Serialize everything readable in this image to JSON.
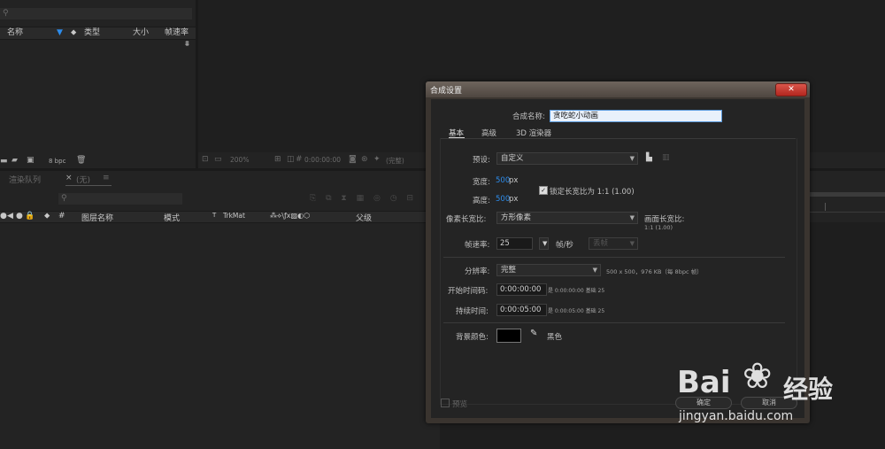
{
  "project_panel": {
    "columns": [
      "名称",
      "类型",
      "大小",
      "帧速率"
    ],
    "bpc": "8 bpc"
  },
  "viewer_bar": {
    "zoom": "200%",
    "timecode": "0:00:00:00",
    "quality": "(完整)"
  },
  "timeline": {
    "tabs": [
      "渲染队列",
      "(无)"
    ],
    "columns": [
      "#",
      "图层名称",
      "模式",
      "T",
      "TrkMat",
      "父级"
    ]
  },
  "dialog": {
    "title": "合成设置",
    "close": "✕",
    "comp_name_label": "合成名称:",
    "comp_name_value": "贪吃蛇小动画",
    "tabs": [
      "基本",
      "高级",
      "3D 渲染器"
    ],
    "preset_label": "预设:",
    "preset_value": "自定义",
    "width_label": "宽度:",
    "width_value": "500",
    "width_unit": "px",
    "height_label": "高度:",
    "height_value": "500",
    "height_unit": "px",
    "lock_label": "锁定长宽比为 1:1 (1.00)",
    "pixel_aspect_label": "像素长宽比:",
    "pixel_aspect_value": "方形像素",
    "frame_aspect_label": "画面长宽比:",
    "frame_aspect_value": "1:1 (1.00)",
    "fps_label": "帧速率:",
    "fps_value": "25",
    "fps_unit": "帧/秒",
    "fps_mode": "丢帧",
    "resolution_label": "分辨率:",
    "resolution_value": "完整",
    "resolution_info": "500 x 500，976 KB（每 8bpc 帧）",
    "start_label": "开始时间码:",
    "start_value": "0:00:00:00",
    "start_info": "是 0:00:00:00  基础 25",
    "duration_label": "持续时间:",
    "duration_value": "0:00:05:00",
    "duration_info": "是 0:00:05:00  基础 25",
    "bg_label": "背景颜色:",
    "bg_color": "#000000",
    "bg_name": "黑色",
    "preview_label": "预览",
    "ok": "确定",
    "cancel": "取消"
  },
  "watermark": {
    "brand": "Bai",
    "brand2": "经验",
    "url": "jingyan.baidu.com"
  }
}
